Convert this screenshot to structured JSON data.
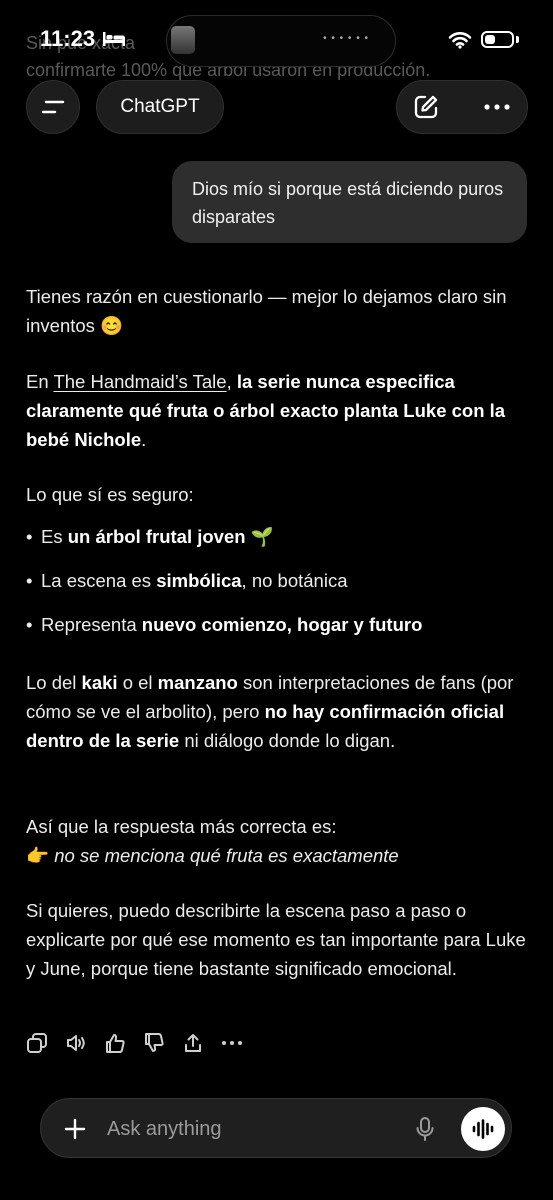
{
  "background_text": {
    "line1": "Sin          pue                                     xacta",
    "line2": "confirmarte 100% qué árbol usaron en producción."
  },
  "status_bar": {
    "time": "11:23",
    "icons": [
      "bed-icon",
      "wifi-icon",
      "battery-icon"
    ],
    "battery_level": 0.3
  },
  "header": {
    "title": "ChatGPT",
    "icons": [
      "menu-icon",
      "edit-icon",
      "more-icon"
    ]
  },
  "user_message": "Dios mío si porque está diciendo puros disparates",
  "assistant": {
    "p1": "Tienes razón en cuestionarlo — mejor lo dejamos claro sin inventos 😊",
    "p2_prefix": "En ",
    "p2_link": "The Handmaid’s Tale",
    "p2_comma": ", ",
    "p2_bold": "la serie nunca especifica claramente qué fruta o árbol exacto planta Luke con la bebé Nichole",
    "p2_end": ".",
    "p3": "Lo que sí es seguro:",
    "bullets": [
      {
        "prefix": "Es ",
        "bold": "un árbol frutal joven",
        "suffix": " 🌱"
      },
      {
        "prefix": "La escena es ",
        "bold": "simbólica",
        "suffix": ", no botánica"
      },
      {
        "prefix": "Representa ",
        "bold": "nuevo comienzo, hogar y futuro",
        "suffix": ""
      }
    ],
    "p4_a": "Lo del ",
    "p4_b": "kaki",
    "p4_c": " o el ",
    "p4_d": "manzano",
    "p4_e": " son interpretaciones de fans (por cómo se ve el arbolito), pero ",
    "p4_f": "no hay confirmación oficial dentro de la serie",
    "p4_g": " ni diálogo donde lo digan.",
    "p5_line1": "Así que la respuesta más correcta es:",
    "p5_emoji": "👉",
    "p5_line2": "no se menciona qué fruta es exactamente",
    "p6": "Si quieres, puedo describirte la escena paso a paso o explicarte por qué ese momento es tan importante para Luke y June, porque tiene bastante significado emocional."
  },
  "message_actions": [
    "copy-icon",
    "read-aloud-icon",
    "thumbs-up-icon",
    "thumbs-down-icon",
    "share-icon",
    "more-icon"
  ],
  "composer": {
    "placeholder": "Ask anything",
    "icons": [
      "plus-icon",
      "mic-icon",
      "voice-mode-icon"
    ]
  }
}
